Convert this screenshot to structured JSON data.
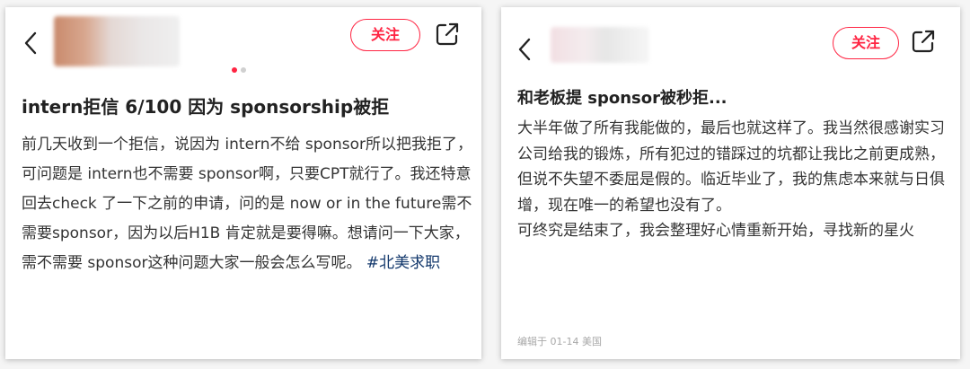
{
  "left_post": {
    "follow_label": "关注",
    "title": "intern拒信 6/100 因为 sponsorship被拒",
    "body": "前几天收到一个拒信，说因为 intern不给 sponsor所以把我拒了，可问题是 intern也不需要 sponsor啊，只要CPT就行了。我还特意回去check 了一下之前的申请，问的是 now or in the future需不需要sponsor，因为以后H1B 肯定就是要得嘛。想请问一下大家，需不需要 sponsor这种问题大家一般会怎么写呢。",
    "hashtag": "#北美求职",
    "carousel": {
      "count": 2,
      "active_index": 0
    }
  },
  "right_post": {
    "follow_label": "关注",
    "title": "和老板提 sponsor被秒拒...",
    "paragraphs": [
      "大半年做了所有我能做的，最后也就这样了。我当然很感谢实习公司给我的锻炼，所有犯过的错踩过的坑都让我比之前更成熟，但说不失望不委屈是假的。临近毕业了，我的焦虑本来就与日俱增，现在唯一的希望也没有了。",
      "可终究是结束了，我会整理好心情重新开始，寻找新的星火"
    ],
    "meta": "编辑于 01-14 美国"
  },
  "icons": {
    "back": "chevron-left-icon",
    "share": "share-external-icon",
    "avatar": "blurred-avatar-icon"
  },
  "colors": {
    "accent": "#ff2442",
    "hashtag": "#13386c",
    "dot_active": "#ff2442",
    "dot_inactive": "#d0d0d0"
  }
}
